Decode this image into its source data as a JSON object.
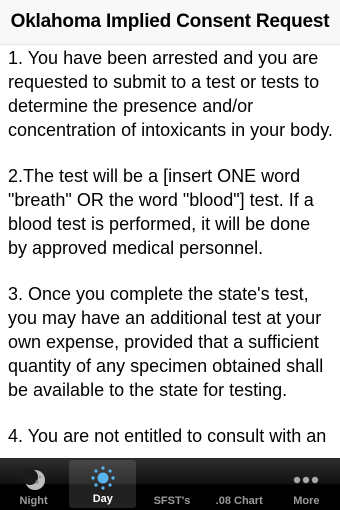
{
  "header": {
    "title": "Oklahoma Implied Consent Request"
  },
  "content": {
    "paragraphs": [
      "1. You have been arrested and you are requested to submit to a test or tests to determine the presence and/or concentration of intoxicants in your body.",
      "2.The test will be a [insert ONE word \"breath\" OR the word \"blood\"] test. If a blood test is performed, it will be done by approved medical personnel.",
      "3. Once you complete the state's test, you may have an additional test at your own expense, provided that a sufficient quantity of any specimen obtained shall be available to the state for testing.",
      "4. You are not entitled to consult with an"
    ]
  },
  "tabbar": {
    "tabs": [
      {
        "label": "Night",
        "icon": "moon-icon",
        "active": false
      },
      {
        "label": "Day",
        "icon": "sun-icon",
        "active": true
      },
      {
        "label": "SFST's",
        "icon": "none",
        "active": false
      },
      {
        "label": ".08 Chart",
        "icon": "none",
        "active": false
      },
      {
        "label": "More",
        "icon": "more-icon",
        "active": false
      }
    ]
  },
  "colors": {
    "header_bg": "#f8f8f8",
    "tabbar_bg": "#000000",
    "active_icon": "#5ab4f0",
    "inactive_label": "#9a9a9a"
  }
}
